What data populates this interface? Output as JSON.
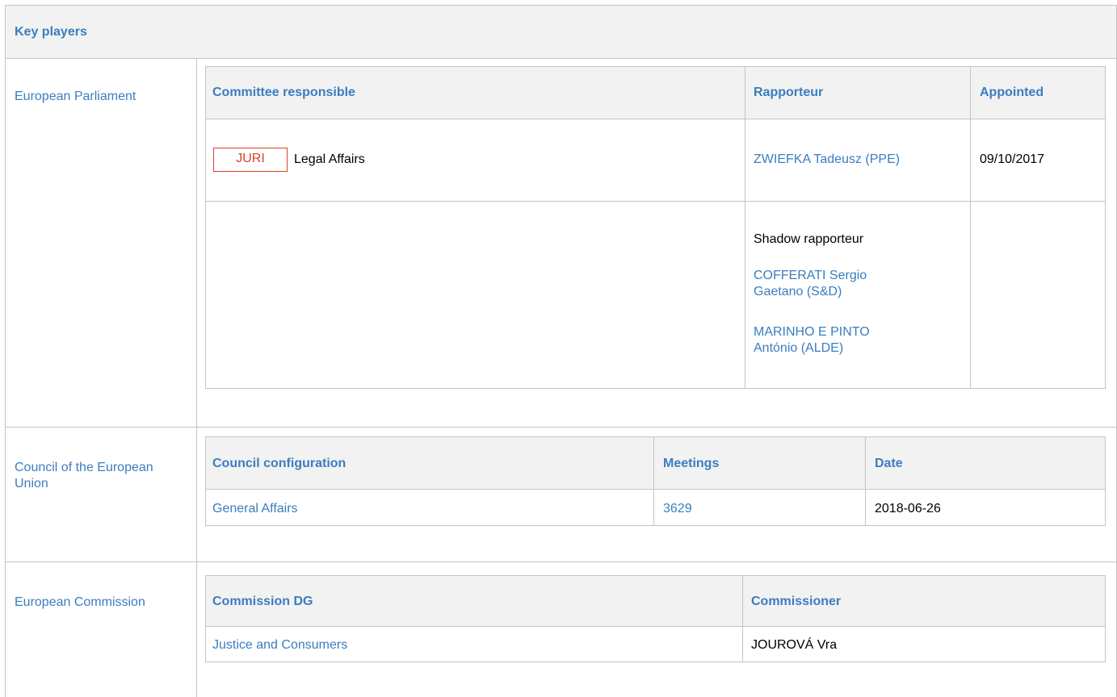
{
  "section_title": "Key players",
  "parliament": {
    "label": "European Parliament",
    "headers": [
      "Committee responsible",
      "Rapporteur",
      "Appointed"
    ],
    "committee_code": "JURI",
    "committee_name": "Legal Affairs",
    "rapporteur": "ZWIEFKA Tadeusz (PPE)",
    "appointed": "09/10/2017",
    "shadow_label": "Shadow rapporteur",
    "shadows": [
      "COFFERATI Sergio Gaetano (S&D)",
      "MARINHO E PINTO António (ALDE)"
    ]
  },
  "council": {
    "label": "Council of the European Union",
    "headers": [
      "Council configuration",
      "Meetings",
      "Date"
    ],
    "rows": [
      {
        "configuration": "General Affairs",
        "meeting": "3629",
        "date": "2018-06-26"
      }
    ]
  },
  "commission": {
    "label": "European Commission",
    "headers": [
      "Commission DG",
      "Commissioner"
    ],
    "rows": [
      {
        "dg": "Justice and Consumers",
        "commissioner": "JOUROVÁ Vra"
      }
    ]
  },
  "colors": {
    "link": "#3b7dbf",
    "badge": "#d9412a",
    "header_bg": "#f2f2f2",
    "border": "#c4c4c4"
  }
}
